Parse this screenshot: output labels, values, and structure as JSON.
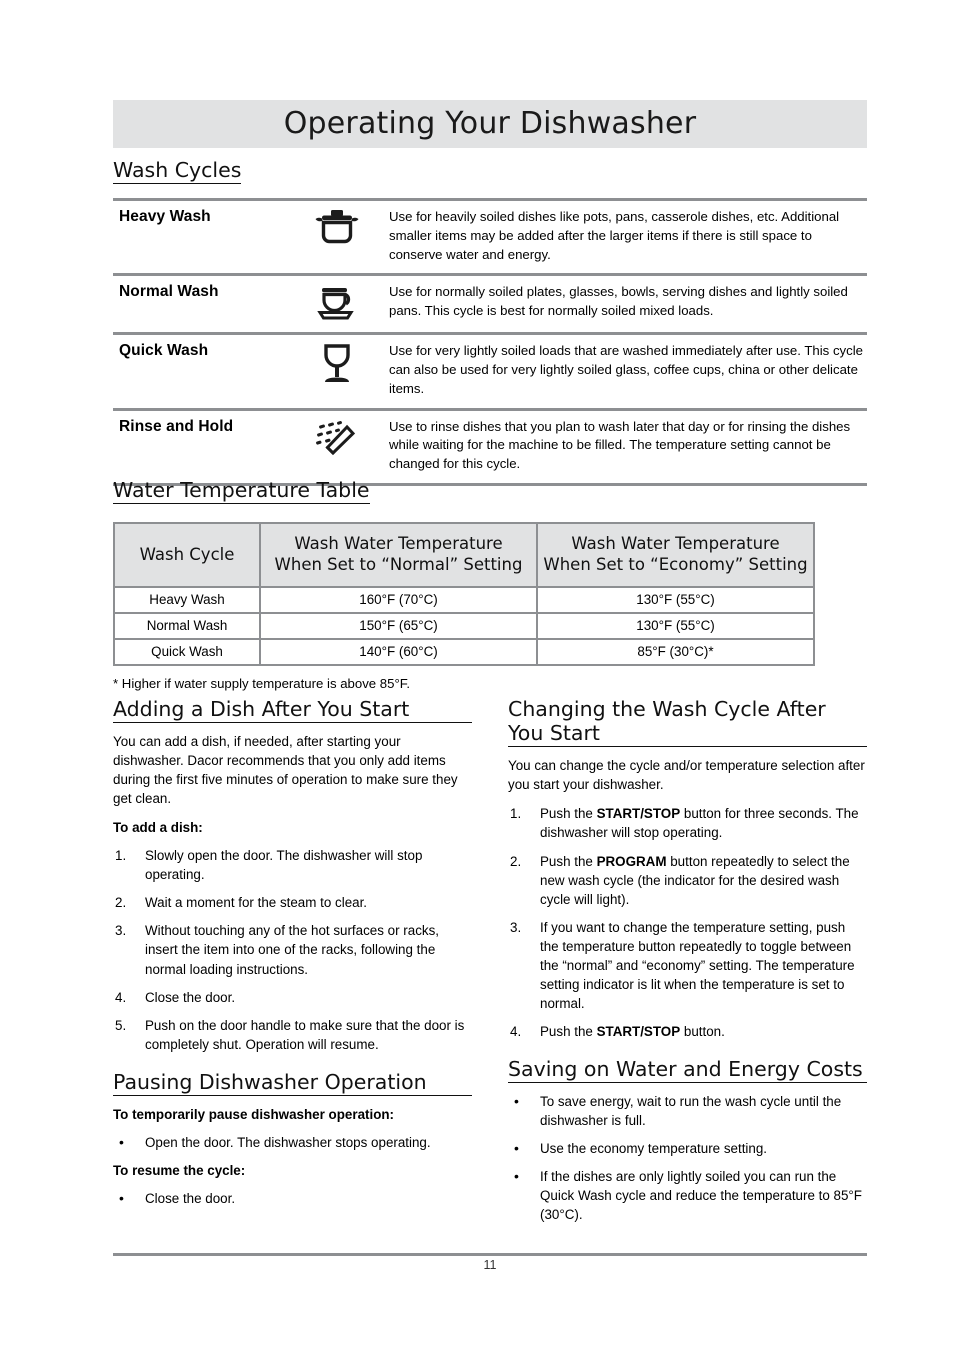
{
  "document": {
    "page_title": "Operating Your Dishwasher",
    "page_number": "11"
  },
  "wash_cycles": {
    "heading": "Wash Cycles",
    "rows": [
      {
        "name": "Heavy Wash",
        "icon": "pot-icon",
        "description": "Use for heavily soiled dishes like pots, pans, casserole dishes, etc. Additional smaller items may be added after the larger items if there is still space to conserve water and energy."
      },
      {
        "name": "Normal Wash",
        "icon": "cup-and-saucer-icon",
        "description": "Use for normally soiled plates, glasses, bowls, serving dishes and lightly soiled pans. This cycle is best for normally soiled mixed loads."
      },
      {
        "name": "Quick Wash",
        "icon": "wine-glass-icon",
        "description": "Use for very lightly soiled loads that are washed immediately after use. This cycle can also be used for very lightly soiled glass, coffee cups, china or other delicate items."
      },
      {
        "name": "Rinse and Hold",
        "icon": "spray-rinse-icon",
        "description": "Use to rinse dishes that you plan to wash later that day or for rinsing the dishes while waiting for the machine to be filled. The temperature setting cannot be changed for this cycle."
      }
    ]
  },
  "water_temperature": {
    "heading": "Water Temperature Table",
    "columns": [
      "Wash Cycle",
      "Wash Water Temperature When Set to “Normal” Setting",
      "Wash Water Temperature When Set to “Economy” Setting"
    ],
    "column_lines": [
      [
        "Wash Cycle"
      ],
      [
        "Wash Water Temperature",
        "When Set to “Normal” Setting"
      ],
      [
        "Wash Water Temperature",
        "When Set to “Economy” Setting"
      ]
    ],
    "rows": [
      {
        "cycle": "Heavy Wash",
        "normal": "160°F (70°C)",
        "economy": "130°F (55°C)"
      },
      {
        "cycle": "Normal Wash",
        "normal": "150°F (65°C)",
        "economy": "130°F (55°C)"
      },
      {
        "cycle": "Quick Wash",
        "normal": "140°F (60°C)",
        "economy": "85°F (30°C)*"
      }
    ],
    "footnote": "* Higher if water supply temperature is above 85°F."
  },
  "adding_dish": {
    "heading": "Adding a Dish After You Start",
    "intro": "You can add a dish, if needed, after starting your dishwasher. Dacor recommends that you only add items during the first five minutes of operation to make sure they get clean.",
    "subheading": "To add a dish:",
    "steps": [
      {
        "marker": "1.",
        "text": "Slowly open the door. The dishwasher will stop operating."
      },
      {
        "marker": "2.",
        "text": "Wait a moment for the steam to clear."
      },
      {
        "marker": "3.",
        "text": "Without touching any of the hot surfaces or racks, insert the item into one of the racks, following the normal loading instructions."
      },
      {
        "marker": "4.",
        "text": "Close the door."
      },
      {
        "marker": "5.",
        "text": "Push on the door handle to make sure that the door is completely shut. Operation will resume."
      }
    ]
  },
  "pausing": {
    "heading": "Pausing Dishwasher Operation",
    "sub1": "To temporarily pause dishwasher operation:",
    "bullet1": {
      "marker": "•",
      "text": "Open the door. The dishwasher stops operating."
    },
    "sub2": "To resume the cycle:",
    "bullet2": {
      "marker": "•",
      "text": "Close the door."
    }
  },
  "changing_cycle": {
    "heading": "Changing the Wash Cycle After You Start",
    "intro": "You can change the cycle and/or temperature selection after you start your dishwasher.",
    "steps": [
      {
        "marker": "1.",
        "pre": "Push the ",
        "strong": "START/STOP",
        "post": " button for three seconds. The dishwasher will stop operating."
      },
      {
        "marker": "2.",
        "pre": "Push the ",
        "strong": "PROGRAM",
        "post": " button repeatedly to select the new wash cycle (the indicator for the desired wash cycle will light)."
      },
      {
        "marker": "3.",
        "pre": "If you want to change the temperature setting, push the temperature button repeatedly to toggle between the “normal” and “economy” setting. The temperature setting indicator is lit when the temperature is set to normal.",
        "strong": "",
        "post": ""
      },
      {
        "marker": "4.",
        "pre": "Push the ",
        "strong": "START/STOP",
        "post": " button."
      }
    ]
  },
  "saving": {
    "heading": "Saving on Water and Energy Costs",
    "bullets": [
      {
        "marker": "•",
        "text": "To save energy, wait to run the wash cycle until the dishwasher is full."
      },
      {
        "marker": "•",
        "text": "Use the economy temperature setting."
      },
      {
        "marker": "•",
        "text": "If the dishes are only lightly soiled you can run the Quick Wash cycle and reduce the temperature to 85°F (30°C)."
      }
    ]
  },
  "colors": {
    "banner_gray": "#e1e2e3",
    "rule_gray": "#8d8f92",
    "text_black": "#000000"
  }
}
